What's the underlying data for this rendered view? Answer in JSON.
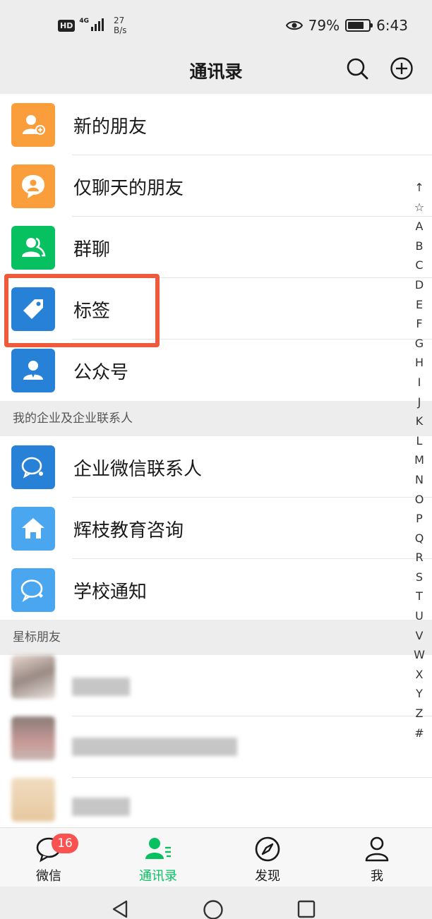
{
  "status_bar": {
    "hd": "HD",
    "network": "4G",
    "speed_value": "27",
    "speed_unit": "B/s",
    "battery": "79%",
    "time": "6:43"
  },
  "header": {
    "title": "通讯录",
    "icons": [
      "search-icon",
      "add-circle-icon"
    ]
  },
  "fixed_items": [
    {
      "label": "新的朋友",
      "icon": "add-friend-icon",
      "color": "#fa9d3b"
    },
    {
      "label": "仅聊天的朋友",
      "icon": "chat-only-friend-icon",
      "color": "#fa9d3b"
    },
    {
      "label": "群聊",
      "icon": "group-chat-icon",
      "color": "#07c160"
    },
    {
      "label": "标签",
      "icon": "tag-icon",
      "color": "#2782d7"
    },
    {
      "label": "公众号",
      "icon": "official-account-icon",
      "color": "#2782d7"
    }
  ],
  "enterprise_section": {
    "title": "我的企业及企业联系人",
    "items": [
      {
        "label": "企业微信联系人",
        "icon": "wecom-icon",
        "color": "#2782d7"
      },
      {
        "label": "辉枝教育咨询",
        "icon": "home-icon",
        "color": "#4aa7ef"
      },
      {
        "label": "学校通知",
        "icon": "school-notice-icon",
        "color": "#4aa7ef"
      }
    ]
  },
  "starred_section": {
    "title": "星标朋友"
  },
  "index_bar": [
    "↑",
    "☆",
    "A",
    "B",
    "C",
    "D",
    "E",
    "F",
    "G",
    "H",
    "I",
    "J",
    "K",
    "L",
    "M",
    "N",
    "O",
    "P",
    "Q",
    "R",
    "S",
    "T",
    "U",
    "V",
    "W",
    "X",
    "Y",
    "Z",
    "#"
  ],
  "tab_bar": {
    "tabs": [
      {
        "label": "微信",
        "icon": "chat-bubble-icon",
        "badge": "16"
      },
      {
        "label": "通讯录",
        "icon": "contacts-icon",
        "active": true
      },
      {
        "label": "发现",
        "icon": "compass-icon"
      },
      {
        "label": "我",
        "icon": "person-icon"
      }
    ]
  },
  "colors": {
    "accent_green": "#07c160",
    "highlight_red": "#ef5a3c",
    "badge_red": "#fa5151"
  }
}
